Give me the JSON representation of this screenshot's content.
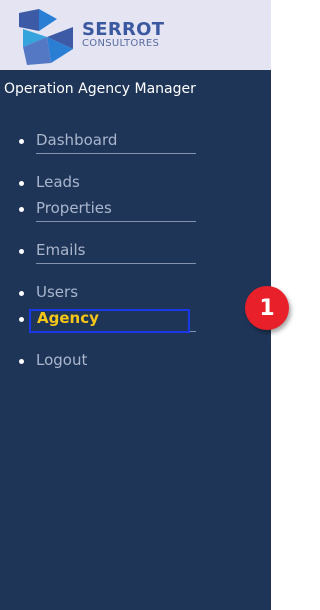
{
  "brand": {
    "name": "SERROT",
    "subtitle": "CONSULTORES"
  },
  "app_title": "Operation Agency Manager",
  "nav": {
    "items": [
      {
        "label": "Dashboard"
      },
      {
        "label": "Leads"
      },
      {
        "label": "Properties"
      },
      {
        "label": "Emails"
      },
      {
        "label": "Users"
      },
      {
        "label": "Agency"
      },
      {
        "label": "Logout"
      }
    ]
  },
  "annotation": {
    "badge": "1"
  },
  "colors": {
    "sidebar": "#1f3558",
    "active_text": "#f5c518",
    "highlight_border": "#1a38e8",
    "badge": "#e8202a"
  }
}
